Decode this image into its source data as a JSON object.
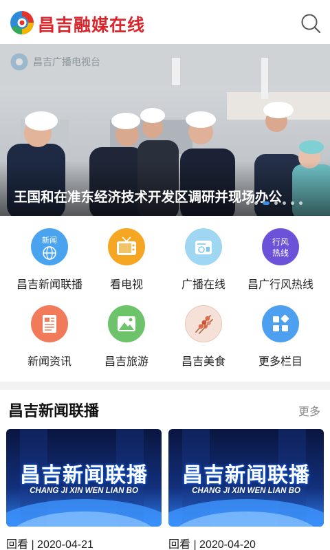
{
  "header": {
    "app_title": "昌吉融媒在线",
    "search_icon": "search-icon"
  },
  "banner": {
    "watermark": "昌吉广播电视台",
    "title": "王国和在准东经济技术开发区调研并现场办公",
    "slide_count": 7,
    "active_slide": 3
  },
  "menu": {
    "items": [
      {
        "label": "昌吉新闻联播",
        "icon": "news-globe-icon",
        "badge": "新闻",
        "color": "#4aa3ef"
      },
      {
        "label": "看电视",
        "icon": "tv-icon",
        "color": "#f5a623"
      },
      {
        "label": "广播在线",
        "icon": "radio-icon",
        "color": "#7cc6f0"
      },
      {
        "label": "昌广行风热线",
        "icon": "hotline-icon",
        "badge_line1": "行风",
        "badge_line2": "热线",
        "color": "#6b52d9"
      },
      {
        "label": "新闻资讯",
        "icon": "document-icon",
        "color": "#f07a5a"
      },
      {
        "label": "昌吉旅游",
        "icon": "landscape-icon",
        "color": "#6cc36a"
      },
      {
        "label": "昌吉美食",
        "icon": "skewer-food-icon",
        "color": "#f3d9cf"
      },
      {
        "label": "更多栏目",
        "icon": "grid-more-icon",
        "color": "#4d9ff0"
      }
    ]
  },
  "section": {
    "title": "昌吉新闻联播",
    "more": "更多",
    "cards": [
      {
        "thumb_title": "昌吉新闻联播",
        "thumb_sub": "CHANG JI XIN WEN LIAN BO",
        "caption": "回看 | 2020-04-21"
      },
      {
        "thumb_title": "昌吉新闻联播",
        "thumb_sub": "CHANG JI XIN WEN LIAN BO",
        "caption": "回看 | 2020-04-20"
      }
    ]
  }
}
